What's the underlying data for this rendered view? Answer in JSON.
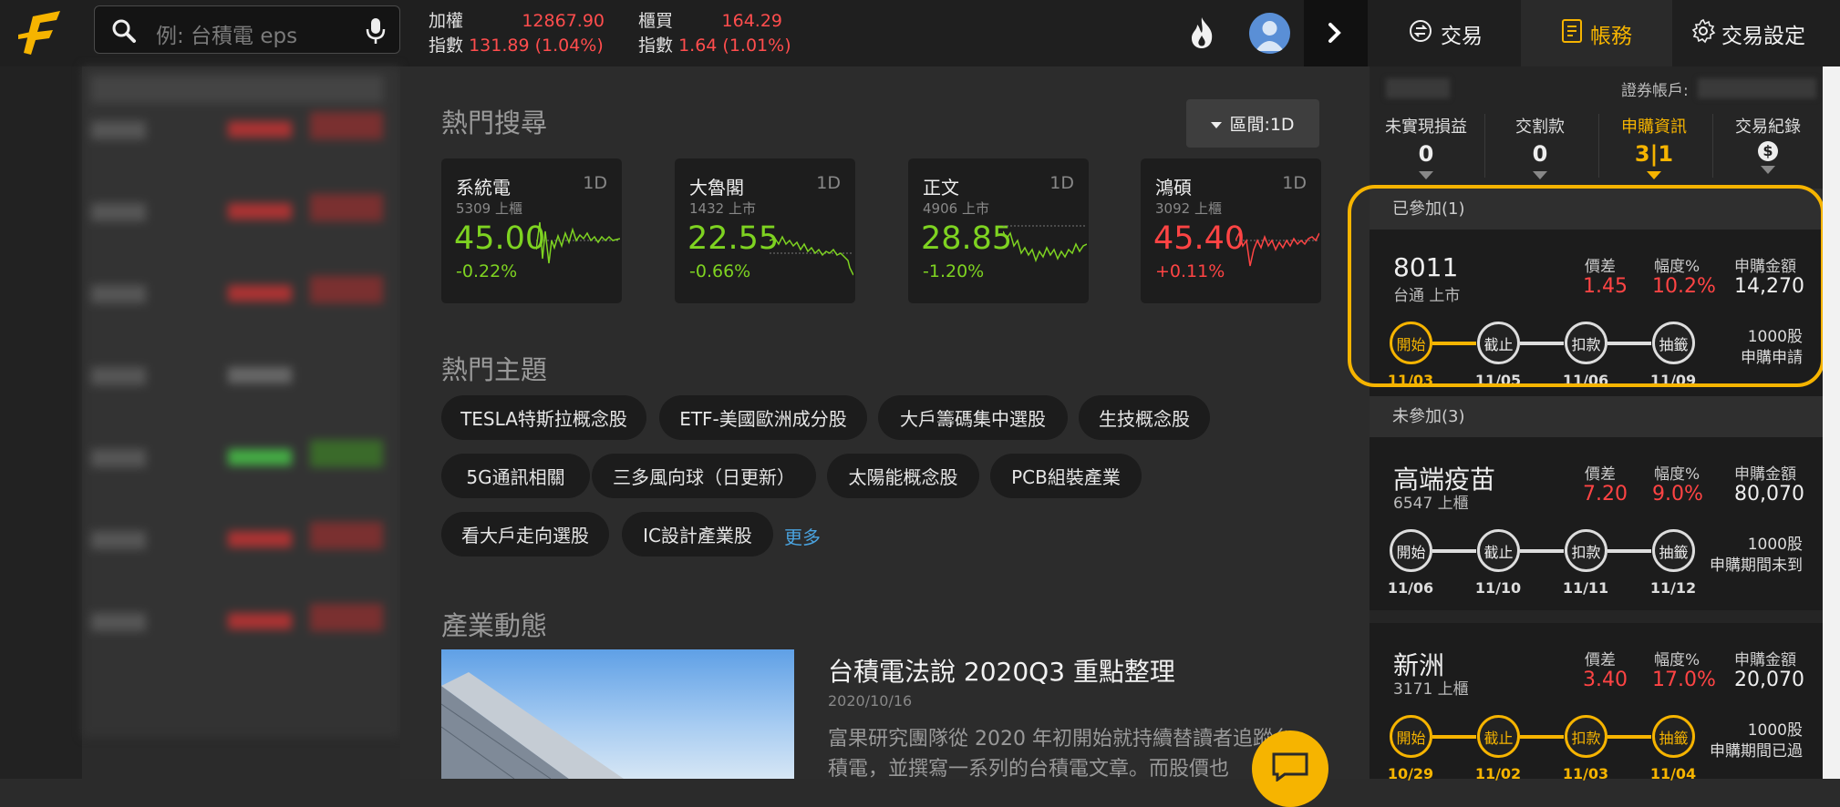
{
  "search": {
    "placeholder": "例: 台積電 eps"
  },
  "indices": [
    {
      "label1": "加權",
      "label2": "指數",
      "value": "12867.90",
      "change": "131.89",
      "pct": "(1.04%)"
    },
    {
      "label1": "櫃買",
      "label2": "指數",
      "value": "164.29",
      "change": "1.64",
      "pct": "(1.01%)"
    }
  ],
  "right_tabs": [
    {
      "label": "交易",
      "icon": "trade-cycle-icon"
    },
    {
      "label": "帳務",
      "icon": "ledger-icon"
    },
    {
      "label": "交易設定",
      "icon": "gear-icon"
    }
  ],
  "hot_search": {
    "title": "熱門搜尋",
    "range_button": "區間:1D",
    "cards": [
      {
        "name": "系統電",
        "period": "1D",
        "code": "5309 上櫃",
        "price": "45.00",
        "change": "-0.22%",
        "color": "#7ed321"
      },
      {
        "name": "大魯閣",
        "period": "1D",
        "code": "1432 上市",
        "price": "22.55",
        "change": "-0.66%",
        "color": "#7ed321"
      },
      {
        "name": "正文",
        "period": "1D",
        "code": "4906 上市",
        "price": "28.85",
        "change": "-1.20%",
        "color": "#7ed321"
      },
      {
        "name": "鴻碩",
        "period": "1D",
        "code": "3092 上櫃",
        "price": "45.40",
        "change": "+0.11%",
        "color": "#ff4444"
      }
    ]
  },
  "hot_topics": {
    "title": "熱門主題",
    "chips": [
      "TESLA特斯拉概念股",
      "ETF-美國歐洲成分股",
      "大戶籌碼集中選股",
      "生技概念股",
      "5G通訊相關",
      "三多風向球（日更新）",
      "太陽能概念股",
      "PCB組裝產業",
      "看大戶走向選股",
      "IC設計產業股"
    ],
    "more": "更多"
  },
  "industry": {
    "title": "產業動態",
    "article_title": "台積電法說 2020Q3 重點整理",
    "article_date": "2020/10/16",
    "article_line1": "富果研究團隊從 2020 年初開始就持續替讀者追蹤台",
    "article_line2": "積電，並撰寫一系列的台積電文章。而股價也"
  },
  "account": {
    "account_label": "證券帳戶:",
    "stats": [
      {
        "title": "未實現損益",
        "value": "0"
      },
      {
        "title": "交割款",
        "value": "0"
      },
      {
        "title": "申購資訊",
        "value": "3|1"
      },
      {
        "title": "交易紀錄",
        "value": "$"
      }
    ]
  },
  "ipo": {
    "joined_label": "已參加(1)",
    "not_joined_label": "未參加(3)",
    "headers": {
      "spread": "價差",
      "pct": "幅度%",
      "amount": "申購金額"
    },
    "steps": [
      "開始",
      "截止",
      "扣款",
      "抽籤"
    ],
    "items": [
      {
        "code": "8011",
        "market": "台通 上市",
        "spread": "1.45",
        "pct": "10.2%",
        "amount": "14,270",
        "shares": "1000股",
        "status": "申購申請",
        "dates": [
          "11/03",
          "11/05",
          "11/06",
          "11/09"
        ],
        "progress_steps": 1
      },
      {
        "code": "高端疫苗",
        "market": "6547 上櫃",
        "spread": "7.20",
        "pct": "9.0%",
        "amount": "80,070",
        "shares": "1000股",
        "status": "申購期間未到",
        "dates": [
          "11/06",
          "11/10",
          "11/11",
          "11/12"
        ],
        "progress_steps": 0
      },
      {
        "code": "新洲",
        "market": "3171 上櫃",
        "spread": "3.40",
        "pct": "17.0%",
        "amount": "20,070",
        "shares": "1000股",
        "status": "申購期間已過",
        "dates": [
          "10/29",
          "11/02",
          "11/03",
          "11/04"
        ],
        "progress_steps": 4
      }
    ]
  },
  "colors": {
    "up": "#ff4444",
    "down": "#7ed321",
    "accent": "#f6b400",
    "link": "#4aa3df"
  }
}
